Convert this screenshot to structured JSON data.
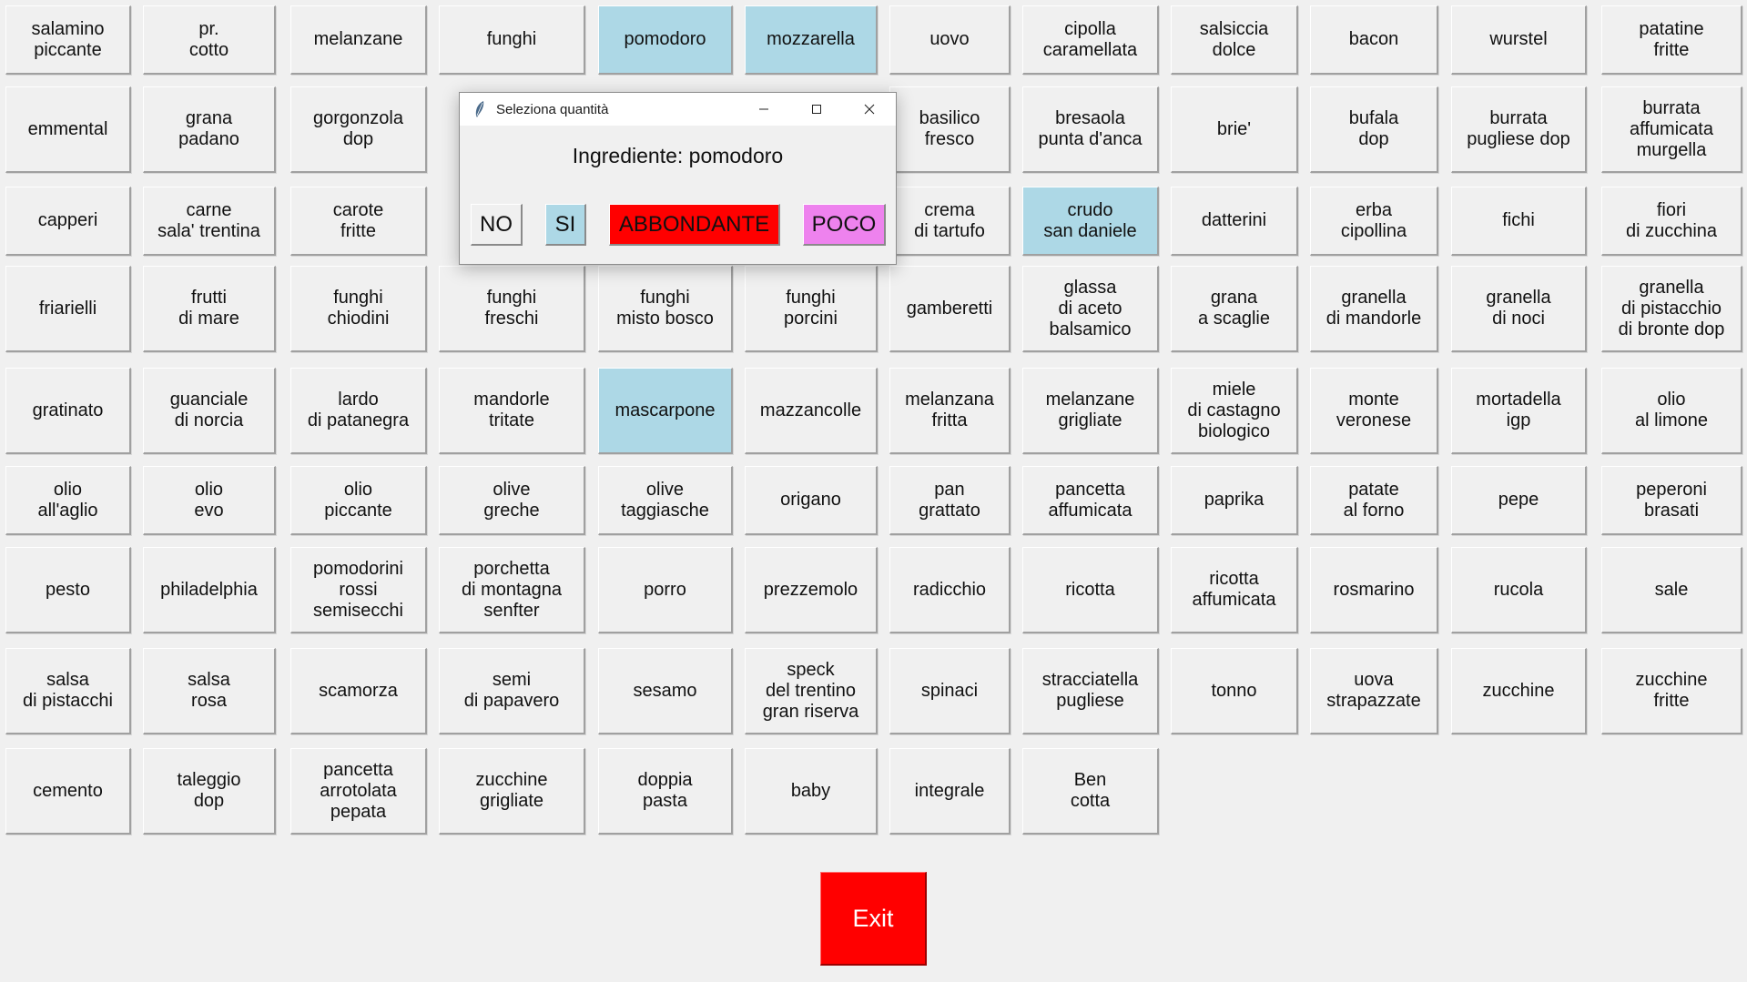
{
  "ingredients": [
    {
      "label": "salamino\npiccante",
      "selected": false
    },
    {
      "label": "pr.\ncotto",
      "selected": false
    },
    {
      "label": "melanzane",
      "selected": false
    },
    {
      "label": "funghi",
      "selected": false
    },
    {
      "label": "pomodoro",
      "selected": true
    },
    {
      "label": "mozzarella",
      "selected": true
    },
    {
      "label": "uovo",
      "selected": false
    },
    {
      "label": "cipolla\ncaramellata",
      "selected": false
    },
    {
      "label": "salsiccia\ndolce",
      "selected": false
    },
    {
      "label": "bacon",
      "selected": false
    },
    {
      "label": "wurstel",
      "selected": false
    },
    {
      "label": "patatine\nfritte",
      "selected": false
    },
    {
      "label": "emmental",
      "selected": false
    },
    {
      "label": "grana\npadano",
      "selected": false
    },
    {
      "label": "gorgonzola\ndop",
      "selected": false
    },
    {
      "label": "",
      "selected": false
    },
    {
      "label": "",
      "selected": false
    },
    {
      "label": "",
      "selected": false
    },
    {
      "label": "basilico\nfresco",
      "selected": false
    },
    {
      "label": "bresaola\npunta d'anca",
      "selected": false
    },
    {
      "label": "brie'",
      "selected": false
    },
    {
      "label": "bufala\ndop",
      "selected": false
    },
    {
      "label": "burrata\npugliese dop",
      "selected": false
    },
    {
      "label": "burrata\naffumicata\nmurgella",
      "selected": false
    },
    {
      "label": "capperi",
      "selected": false
    },
    {
      "label": "carne\nsala' trentina",
      "selected": false
    },
    {
      "label": "carote\nfritte",
      "selected": false
    },
    {
      "label": "",
      "selected": false
    },
    {
      "label": "",
      "selected": false
    },
    {
      "label": "",
      "selected": false
    },
    {
      "label": "crema\ndi tartufo",
      "selected": false
    },
    {
      "label": "crudo\nsan daniele",
      "selected": true
    },
    {
      "label": "datterini",
      "selected": false
    },
    {
      "label": "erba\ncipollina",
      "selected": false
    },
    {
      "label": "fichi",
      "selected": false
    },
    {
      "label": "fiori\ndi zucchina",
      "selected": false
    },
    {
      "label": "friarielli",
      "selected": false
    },
    {
      "label": "frutti\ndi mare",
      "selected": false
    },
    {
      "label": "funghi\nchiodini",
      "selected": false
    },
    {
      "label": "funghi\nfreschi",
      "selected": false
    },
    {
      "label": "funghi\nmisto bosco",
      "selected": false
    },
    {
      "label": "funghi\nporcini",
      "selected": false
    },
    {
      "label": "gamberetti",
      "selected": false
    },
    {
      "label": "glassa\ndi aceto\nbalsamico",
      "selected": false
    },
    {
      "label": "grana\na scaglie",
      "selected": false
    },
    {
      "label": "granella\ndi mandorle",
      "selected": false
    },
    {
      "label": "granella\ndi noci",
      "selected": false
    },
    {
      "label": "granella\ndi pistacchio\ndi bronte dop",
      "selected": false
    },
    {
      "label": "gratinato",
      "selected": false
    },
    {
      "label": "guanciale\ndi norcia",
      "selected": false
    },
    {
      "label": "lardo\ndi patanegra",
      "selected": false
    },
    {
      "label": "mandorle\ntritate",
      "selected": false
    },
    {
      "label": "mascarpone",
      "selected": true
    },
    {
      "label": "mazzancolle",
      "selected": false
    },
    {
      "label": "melanzana\nfritta",
      "selected": false
    },
    {
      "label": "melanzane\ngrigliate",
      "selected": false
    },
    {
      "label": "miele\ndi castagno\nbiologico",
      "selected": false
    },
    {
      "label": "monte\nveronese",
      "selected": false
    },
    {
      "label": "mortadella\nigp",
      "selected": false
    },
    {
      "label": "olio\nal limone",
      "selected": false
    },
    {
      "label": "olio\nall'aglio",
      "selected": false
    },
    {
      "label": "olio\nevo",
      "selected": false
    },
    {
      "label": "olio\npiccante",
      "selected": false
    },
    {
      "label": "olive\ngreche",
      "selected": false
    },
    {
      "label": "olive\ntaggiasche",
      "selected": false
    },
    {
      "label": "origano",
      "selected": false
    },
    {
      "label": "pan\ngrattato",
      "selected": false
    },
    {
      "label": "pancetta\naffumicata",
      "selected": false
    },
    {
      "label": "paprika",
      "selected": false
    },
    {
      "label": "patate\nal forno",
      "selected": false
    },
    {
      "label": "pepe",
      "selected": false
    },
    {
      "label": "peperoni\nbrasati",
      "selected": false
    },
    {
      "label": "pesto",
      "selected": false
    },
    {
      "label": "philadelphia",
      "selected": false
    },
    {
      "label": "pomodorini\nrossi\nsemisecchi",
      "selected": false
    },
    {
      "label": "porchetta\ndi montagna\nsenfter",
      "selected": false
    },
    {
      "label": "porro",
      "selected": false
    },
    {
      "label": "prezzemolo",
      "selected": false
    },
    {
      "label": "radicchio",
      "selected": false
    },
    {
      "label": "ricotta",
      "selected": false
    },
    {
      "label": "ricotta\naffumicata",
      "selected": false
    },
    {
      "label": "rosmarino",
      "selected": false
    },
    {
      "label": "rucola",
      "selected": false
    },
    {
      "label": "sale",
      "selected": false
    },
    {
      "label": "salsa\ndi pistacchi",
      "selected": false
    },
    {
      "label": "salsa\nrosa",
      "selected": false
    },
    {
      "label": "scamorza",
      "selected": false
    },
    {
      "label": "semi\ndi papavero",
      "selected": false
    },
    {
      "label": "sesamo",
      "selected": false
    },
    {
      "label": "speck\ndel trentino\ngran riserva",
      "selected": false
    },
    {
      "label": "spinaci",
      "selected": false
    },
    {
      "label": "stracciatella\npugliese",
      "selected": false
    },
    {
      "label": "tonno",
      "selected": false
    },
    {
      "label": "uova\nstrapazzate",
      "selected": false
    },
    {
      "label": "zucchine",
      "selected": false
    },
    {
      "label": "zucchine\nfritte",
      "selected": false
    },
    {
      "label": "cemento",
      "selected": false
    },
    {
      "label": "taleggio\ndop",
      "selected": false
    },
    {
      "label": "pancetta\narrotolata\npepata",
      "selected": false
    },
    {
      "label": "zucchine\ngrigliate",
      "selected": false
    },
    {
      "label": "doppia\npasta",
      "selected": false
    },
    {
      "label": "baby",
      "selected": false
    },
    {
      "label": "integrale",
      "selected": false
    },
    {
      "label": "Ben\ncotta",
      "selected": false
    }
  ],
  "exit": {
    "label": "Exit"
  },
  "dialog": {
    "title": "Seleziona quantità",
    "app_icon": "feather-icon",
    "heading": "Ingrediente: pomodoro",
    "buttons": {
      "no": "NO",
      "si": "SI",
      "abbondante": "ABBONDANTE",
      "poco": "POCO"
    }
  },
  "colors": {
    "selected_bg": "#add8e6",
    "default_bg": "#f0f0f0",
    "exit_bg": "#ff0000",
    "abbondante_bg": "#ff0000",
    "poco_bg": "#ee82ee",
    "si_bg": "#add8e6"
  }
}
